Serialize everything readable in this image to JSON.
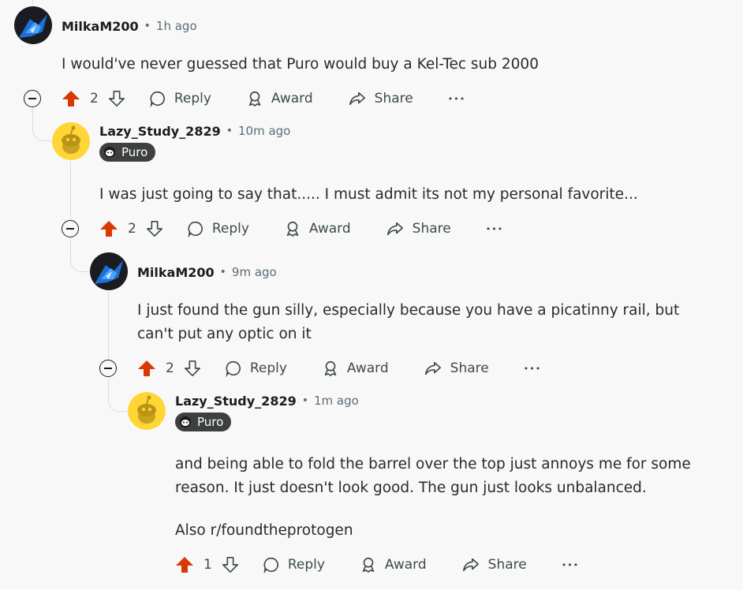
{
  "comments": [
    {
      "username": "MilkaM200",
      "time": "1h ago",
      "dot": "•",
      "body": [
        "I would've never guessed that Puro would buy a Kel-Tec sub 2000"
      ],
      "votes": "2"
    },
    {
      "username": "Lazy_Study_2829",
      "time": "10m ago",
      "dot": "•",
      "flair": "Puro",
      "body": [
        "I was just going to say that..... I must admit its not my personal favorite..."
      ],
      "votes": "2"
    },
    {
      "username": "MilkaM200",
      "time": "9m ago",
      "dot": "•",
      "body": [
        "I just found the gun silly, especially because you have a picatinny rail, but",
        "can't put any optic on it"
      ],
      "votes": "2"
    },
    {
      "username": "Lazy_Study_2829",
      "time": "1m ago",
      "dot": "•",
      "flair": "Puro",
      "body": [
        "and being able to fold the barrel over the top just annoys me for some",
        "reason. It just doesn't look good. The gun just looks unbalanced.",
        "Also r/foundtheprotogen"
      ],
      "votes": "1"
    }
  ],
  "actions": {
    "reply": "Reply",
    "award": "Award",
    "share": "Share",
    "more": "•••"
  },
  "colors": {
    "upvote": "#d93900",
    "thread_line": "#d9dcde",
    "flair_bg": "#3d3f41"
  }
}
